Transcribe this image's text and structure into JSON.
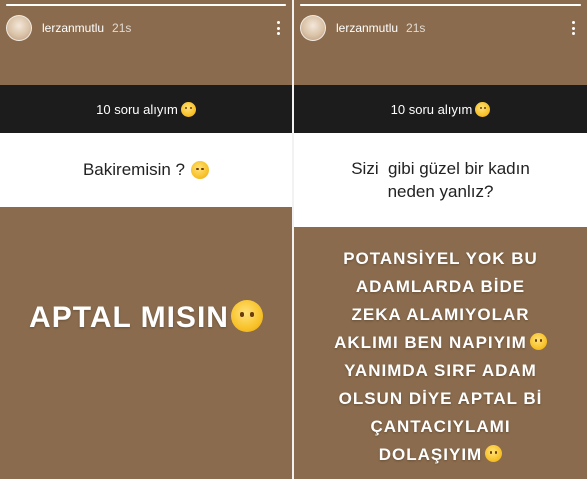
{
  "stories": [
    {
      "username": "lerzanmutlu",
      "time": "21s",
      "progress": 1.0,
      "question_header": "10 soru alıyım",
      "question_emoji": "relieved-face-emoji",
      "question_text": "Bakiremisin ?",
      "question_text_emoji": "grimacing-face-emoji",
      "answer_lines": [
        "APTAL MISIN"
      ],
      "answer_emoji": "eye-roll-emoji"
    },
    {
      "username": "lerzanmutlu",
      "time": "21s",
      "progress": 1.0,
      "question_header": "10 soru alıyım",
      "question_emoji": "relieved-face-emoji",
      "question_lines": [
        "Sizi  gibi güzel bir kadın",
        "neden yanlız?"
      ],
      "answer_lines": [
        "POTANSİYEL YOK BU",
        "ADAMLARDA BİDE",
        "ZEKA ALAMIYOLAR",
        "AKLIMI BEN NAPIYIM",
        "YANIMDA SIRF ADAM",
        "OLSUN DİYE APTAL Bİ",
        "ÇANTACIYLAMI",
        "DOLAŞIYIM"
      ],
      "answer_line_emojis": {
        "3": "relieved-face-emoji",
        "7": "unamused-face-emoji"
      }
    }
  ],
  "colors": {
    "background_brown": "#8a6b4d",
    "question_header_bg": "#1c1c1c",
    "question_body_bg": "#ffffff"
  }
}
